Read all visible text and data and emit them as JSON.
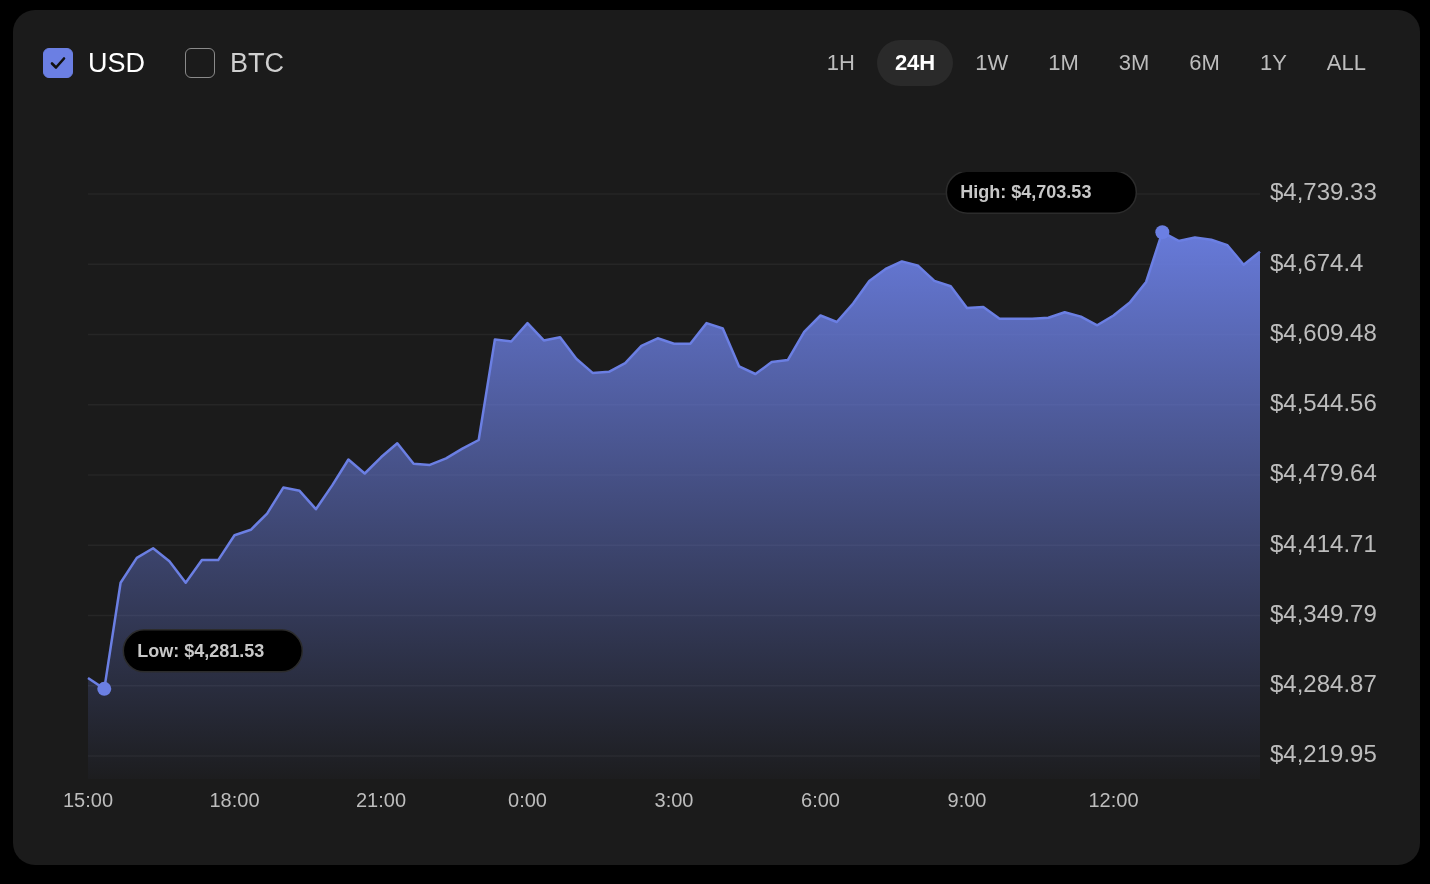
{
  "currencies": [
    {
      "label": "USD",
      "checked": true
    },
    {
      "label": "BTC",
      "checked": false
    }
  ],
  "ranges": [
    {
      "label": "1H",
      "selected": false
    },
    {
      "label": "24H",
      "selected": true
    },
    {
      "label": "1W",
      "selected": false
    },
    {
      "label": "1M",
      "selected": false
    },
    {
      "label": "3M",
      "selected": false
    },
    {
      "label": "6M",
      "selected": false
    },
    {
      "label": "1Y",
      "selected": false
    },
    {
      "label": "ALL",
      "selected": false
    }
  ],
  "chart": {
    "chart_data": {
      "type": "area",
      "categories": [
        "15:00",
        null,
        null,
        null,
        null,
        null,
        null,
        null,
        null,
        "18:00",
        null,
        null,
        null,
        null,
        null,
        null,
        null,
        null,
        "21:00",
        null,
        null,
        null,
        null,
        null,
        null,
        null,
        null,
        "0:00",
        null,
        null,
        null,
        null,
        null,
        null,
        null,
        null,
        "3:00",
        null,
        null,
        null,
        null,
        null,
        null,
        null,
        null,
        "6:00",
        null,
        null,
        null,
        null,
        null,
        null,
        null,
        null,
        "9:00",
        null,
        null,
        null,
        null,
        null,
        null,
        null,
        null,
        "12:00",
        null,
        null,
        null,
        null,
        null,
        null,
        null,
        null,
        null
      ],
      "series": [
        {
          "color": "#6b7fe3",
          "values": [
            4292,
            4282,
            4380,
            4403,
            4412,
            4400,
            4380,
            4401,
            4401,
            4424,
            4429,
            4444,
            4468,
            4465,
            4448,
            4470,
            4494,
            4481,
            4496,
            4509,
            4490,
            4489,
            4495,
            4504,
            4512,
            4605,
            4603,
            4620,
            4604,
            4607,
            4587,
            4574,
            4575,
            4583,
            4599,
            4606,
            4601,
            4601,
            4620,
            4615,
            4580,
            4573,
            4584,
            4586,
            4612,
            4627,
            4621,
            4638,
            4659,
            4670,
            4677,
            4673,
            4659,
            4654,
            4634,
            4635,
            4624,
            4624,
            4624,
            4625,
            4630,
            4626,
            4618,
            4627,
            4639,
            4658,
            4704,
            4696,
            4699,
            4697,
            4692,
            4674,
            4686
          ]
        }
      ],
      "grid": true,
      "ylim": [
        4219.95,
        4739.33
      ],
      "yticks": [
        {
          "value": 4739.33,
          "label": "$4,739.33"
        },
        {
          "value": 4674.4,
          "label": "$4,674.4"
        },
        {
          "value": 4609.48,
          "label": "$4,609.48"
        },
        {
          "value": 4544.56,
          "label": "$4,544.56"
        },
        {
          "value": 4479.64,
          "label": "$4,479.64"
        },
        {
          "value": 4414.71,
          "label": "$4,414.71"
        },
        {
          "value": 4349.79,
          "label": "$4,349.79"
        },
        {
          "value": 4284.87,
          "label": "$4,284.87"
        },
        {
          "value": 4219.95,
          "label": "$4,219.95"
        }
      ]
    },
    "tooltips": [
      {
        "kind": "high",
        "label": "High: $4,703.53"
      },
      {
        "kind": "low",
        "label": "Low: $4,281.53"
      }
    ]
  }
}
